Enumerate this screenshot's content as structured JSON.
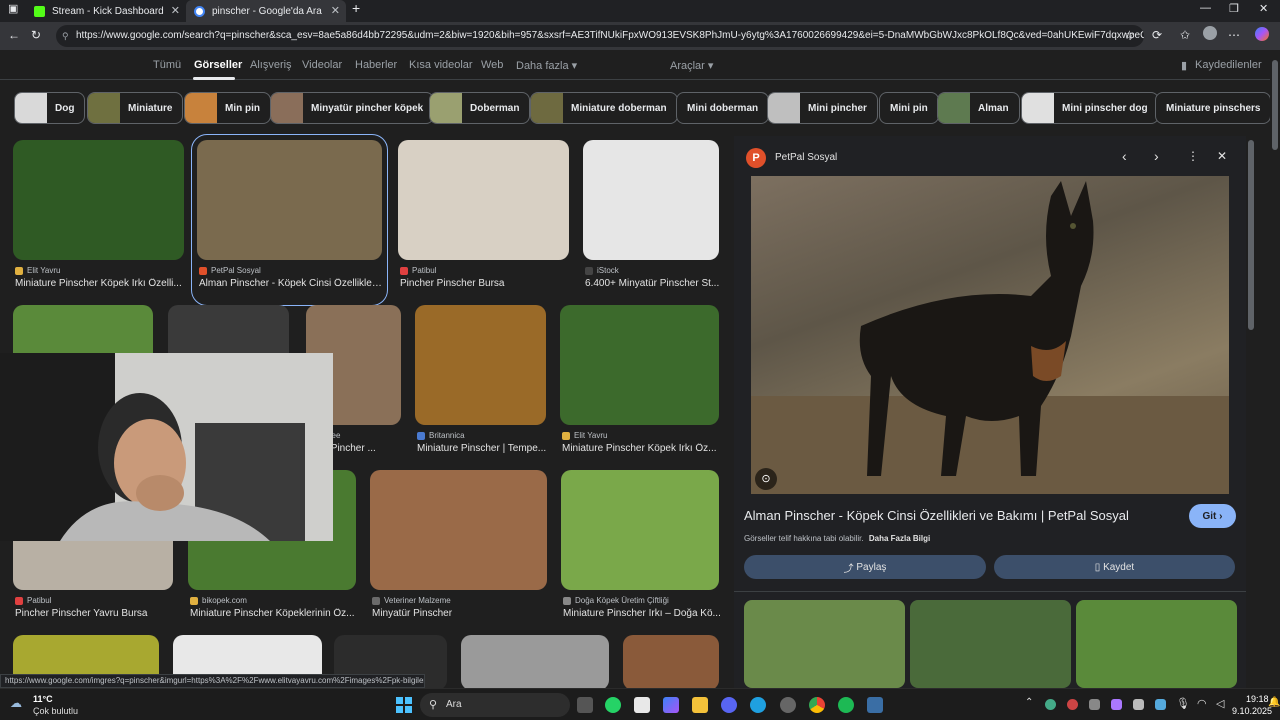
{
  "browser": {
    "tabs": [
      {
        "title": "Stream - Kick Dashboard",
        "favicon_color": "#53fc18"
      },
      {
        "title": "pinscher - Google'da Ara",
        "favicon_color": "#4285f4"
      }
    ],
    "new_tab": "+",
    "url": "https://www.google.com/search?q=pinscher&sca_esv=8ae5a86d4bb72295&udm=2&biw=1920&bih=957&sxsrf=AE3TifNUkiFpxWO913EVSK8PhJmU-y6ytg%3A1760026699429&ei=5-DnaMWbGbWJxc8PkOLf8Qc&ved=0ahUKEwiF7dqxwpeQAxW1RPE..."
  },
  "nav": {
    "tabs": [
      "Tümü",
      "Görseller",
      "Alışveriş",
      "Videolar",
      "Haberler",
      "Kısa videolar",
      "Web",
      "Daha fazla ▾"
    ],
    "tools": "Araçlar ▾",
    "saved": "Kaydedilenler"
  },
  "chips": [
    {
      "label": "Dog",
      "thumb": "#d9d9d9"
    },
    {
      "label": "Miniature",
      "thumb": "#6f7040"
    },
    {
      "label": "Min pin",
      "thumb": "#c8823c"
    },
    {
      "label": "Minyatür pincher köpek",
      "thumb": "#8a6e5a"
    },
    {
      "label": "Doberman",
      "thumb": "#9aa070"
    },
    {
      "label": "Miniature doberman",
      "thumb": "#6e6a40"
    },
    {
      "label": "Mini doberman",
      "thumb": ""
    },
    {
      "label": "Mini pincher",
      "thumb": "#bfbfbf"
    },
    {
      "label": "Mini pin",
      "thumb": ""
    },
    {
      "label": "Alman",
      "thumb": "#5e7a50"
    },
    {
      "label": "Mini pinscher dog",
      "thumb": "#e0e0e0"
    },
    {
      "label": "Miniature pinschers",
      "thumb": ""
    }
  ],
  "results": [
    {
      "source": "Elit Yavru",
      "caption": "Miniature Pinscher Köpek Irkı Özelli...",
      "color": "#2f5a24",
      "icon": "#e0b040"
    },
    {
      "source": "PetPal Sosyal",
      "caption": "Alman Pinscher - Köpek Cinsi Özellikleri ...",
      "color": "#7a6a4e",
      "icon": "#e0502a"
    },
    {
      "source": "Patibul",
      "caption": "Pincher Pinscher Bursa",
      "color": "#d8d0c4",
      "icon": "#e04040"
    },
    {
      "source": "iStock",
      "caption": "6.400+ Minyatür Pinscher St...",
      "color": "#e6e6e6",
      "icon": "#444"
    },
    {
      "source": "",
      "caption": "",
      "color": "#5a8a3a",
      "icon": ""
    },
    {
      "source": "",
      "caption": "",
      "color": "#3a3a3a",
      "icon": ""
    },
    {
      "source": "...tree",
      "caption": "...tür Pincher ...",
      "color": "#8a7058",
      "icon": ""
    },
    {
      "source": "Britannica",
      "caption": "Miniature Pinscher | Tempe...",
      "color": "#9a6a28",
      "icon": "#4a7ad0"
    },
    {
      "source": "Elit Yavru",
      "caption": "Miniature Pinscher Köpek Irkı Öz...",
      "color": "#3c6a2c",
      "icon": "#e0b040"
    },
    {
      "source": "Patibul",
      "caption": "Pincher Pinscher Yavru Bursa",
      "color": "#b8b0a4",
      "icon": "#e04040"
    },
    {
      "source": "bikopek.com",
      "caption": "Miniature Pinscher Köpeklerinin Öz...",
      "color": "#4a7a30",
      "icon": "#e0b040"
    },
    {
      "source": "Veteriner Malzeme",
      "caption": "Minyatür Pinscher",
      "color": "#9a6a48",
      "icon": "#6a6a6a"
    },
    {
      "source": "Doğa Köpek Üretim Çiftliği",
      "caption": "Miniature Pinscher Irkı – Doğa Kö...",
      "color": "#7aa84a",
      "icon": "#888"
    },
    {
      "source": "",
      "caption": "",
      "color": "#a8a830",
      "icon": ""
    },
    {
      "source": "",
      "caption": "",
      "color": "#e8e8e8",
      "icon": ""
    },
    {
      "source": "",
      "caption": "",
      "color": "#2c2c2c",
      "icon": ""
    },
    {
      "source": "",
      "caption": "",
      "color": "#9a9a9a",
      "icon": ""
    },
    {
      "source": "",
      "caption": "",
      "color": "#8a5a3a",
      "icon": ""
    }
  ],
  "panel": {
    "site": "PetPal Sosyal",
    "title": "Alman Pinscher - Köpek Cinsi Özellikleri ve Bakımı | PetPal Sosyal",
    "go": "Git",
    "copyright": "Görseller telif hakkına tabi olabilir.",
    "more_info": "Daha Fazla Bilgi",
    "share": "Paylaş",
    "save": "Kaydet",
    "related_colors": [
      "#6a8a4a",
      "#4a6a3a",
      "#5a8a3a"
    ]
  },
  "status_url": "https://www.google.com/imgres?q=pinscher&imgurl=https%3A%2F%2Fwww.elitvayavru.com%2Fimages%2Fpk-bilgiler...",
  "taskbar": {
    "weather_temp": "11°C",
    "weather_desc": "Çok bulutlu",
    "search": "Ara",
    "time": "19:18",
    "date": "9.10.2025"
  }
}
